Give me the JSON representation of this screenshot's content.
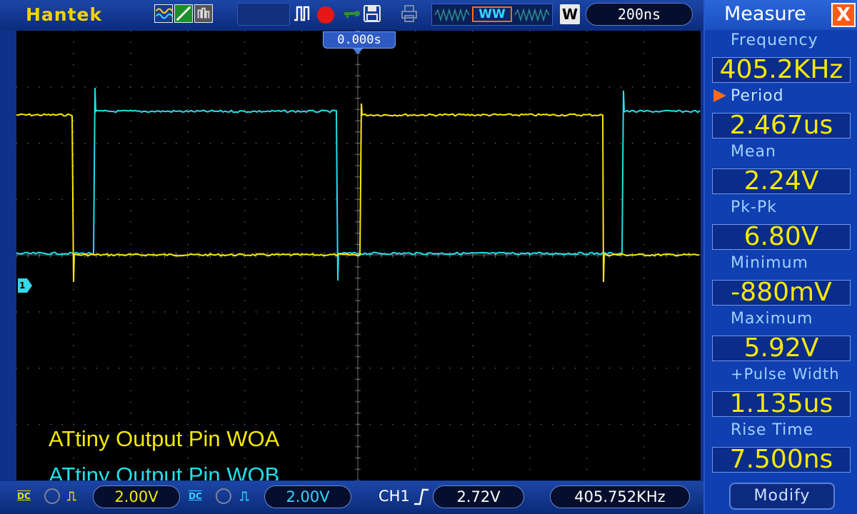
{
  "app": {
    "brand": "Hantek"
  },
  "toolbar": {
    "timebase": "200ns",
    "window_label": "WW",
    "w_button": "W",
    "icons": [
      "math-wave-icon",
      "ramp-icon",
      "persistence-icon",
      "pulse-icon",
      "record-icon",
      "key-icon",
      "save-icon",
      "printer-icon"
    ]
  },
  "screen": {
    "trigger_time": "0.000s",
    "ch1_marker": "1",
    "annotations": {
      "woa": "ATtiny Output Pin WOA",
      "wob": "ATtiny Output Pin WOB"
    },
    "colors": {
      "ch1": "#f5ea00",
      "ch2": "#22e0ec",
      "grid": "#5a5a5a"
    }
  },
  "measure": {
    "title": "Measure",
    "close": "X",
    "items": [
      {
        "label": "Frequency",
        "value": "405.2KHz"
      },
      {
        "label": "Period",
        "value": "2.467us",
        "active": true
      },
      {
        "label": "Mean",
        "value": "2.24V"
      },
      {
        "label": "Pk-Pk",
        "value": "6.80V"
      },
      {
        "label": "Minimum",
        "value": "-880mV"
      },
      {
        "label": "Maximum",
        "value": "5.92V"
      },
      {
        "label": "+Pulse Width",
        "value": "1.135us"
      },
      {
        "label": "Rise Time",
        "value": "7.500ns"
      }
    ],
    "modify": "Modify"
  },
  "bottom": {
    "ch1_coupling": "DC",
    "ch1_volts": "2.00V",
    "ch2_coupling": "DC",
    "ch2_volts": "2.00V",
    "trigger_source": "CH1",
    "trigger_level": "2.72V",
    "frequency": "405.752KHz"
  }
}
